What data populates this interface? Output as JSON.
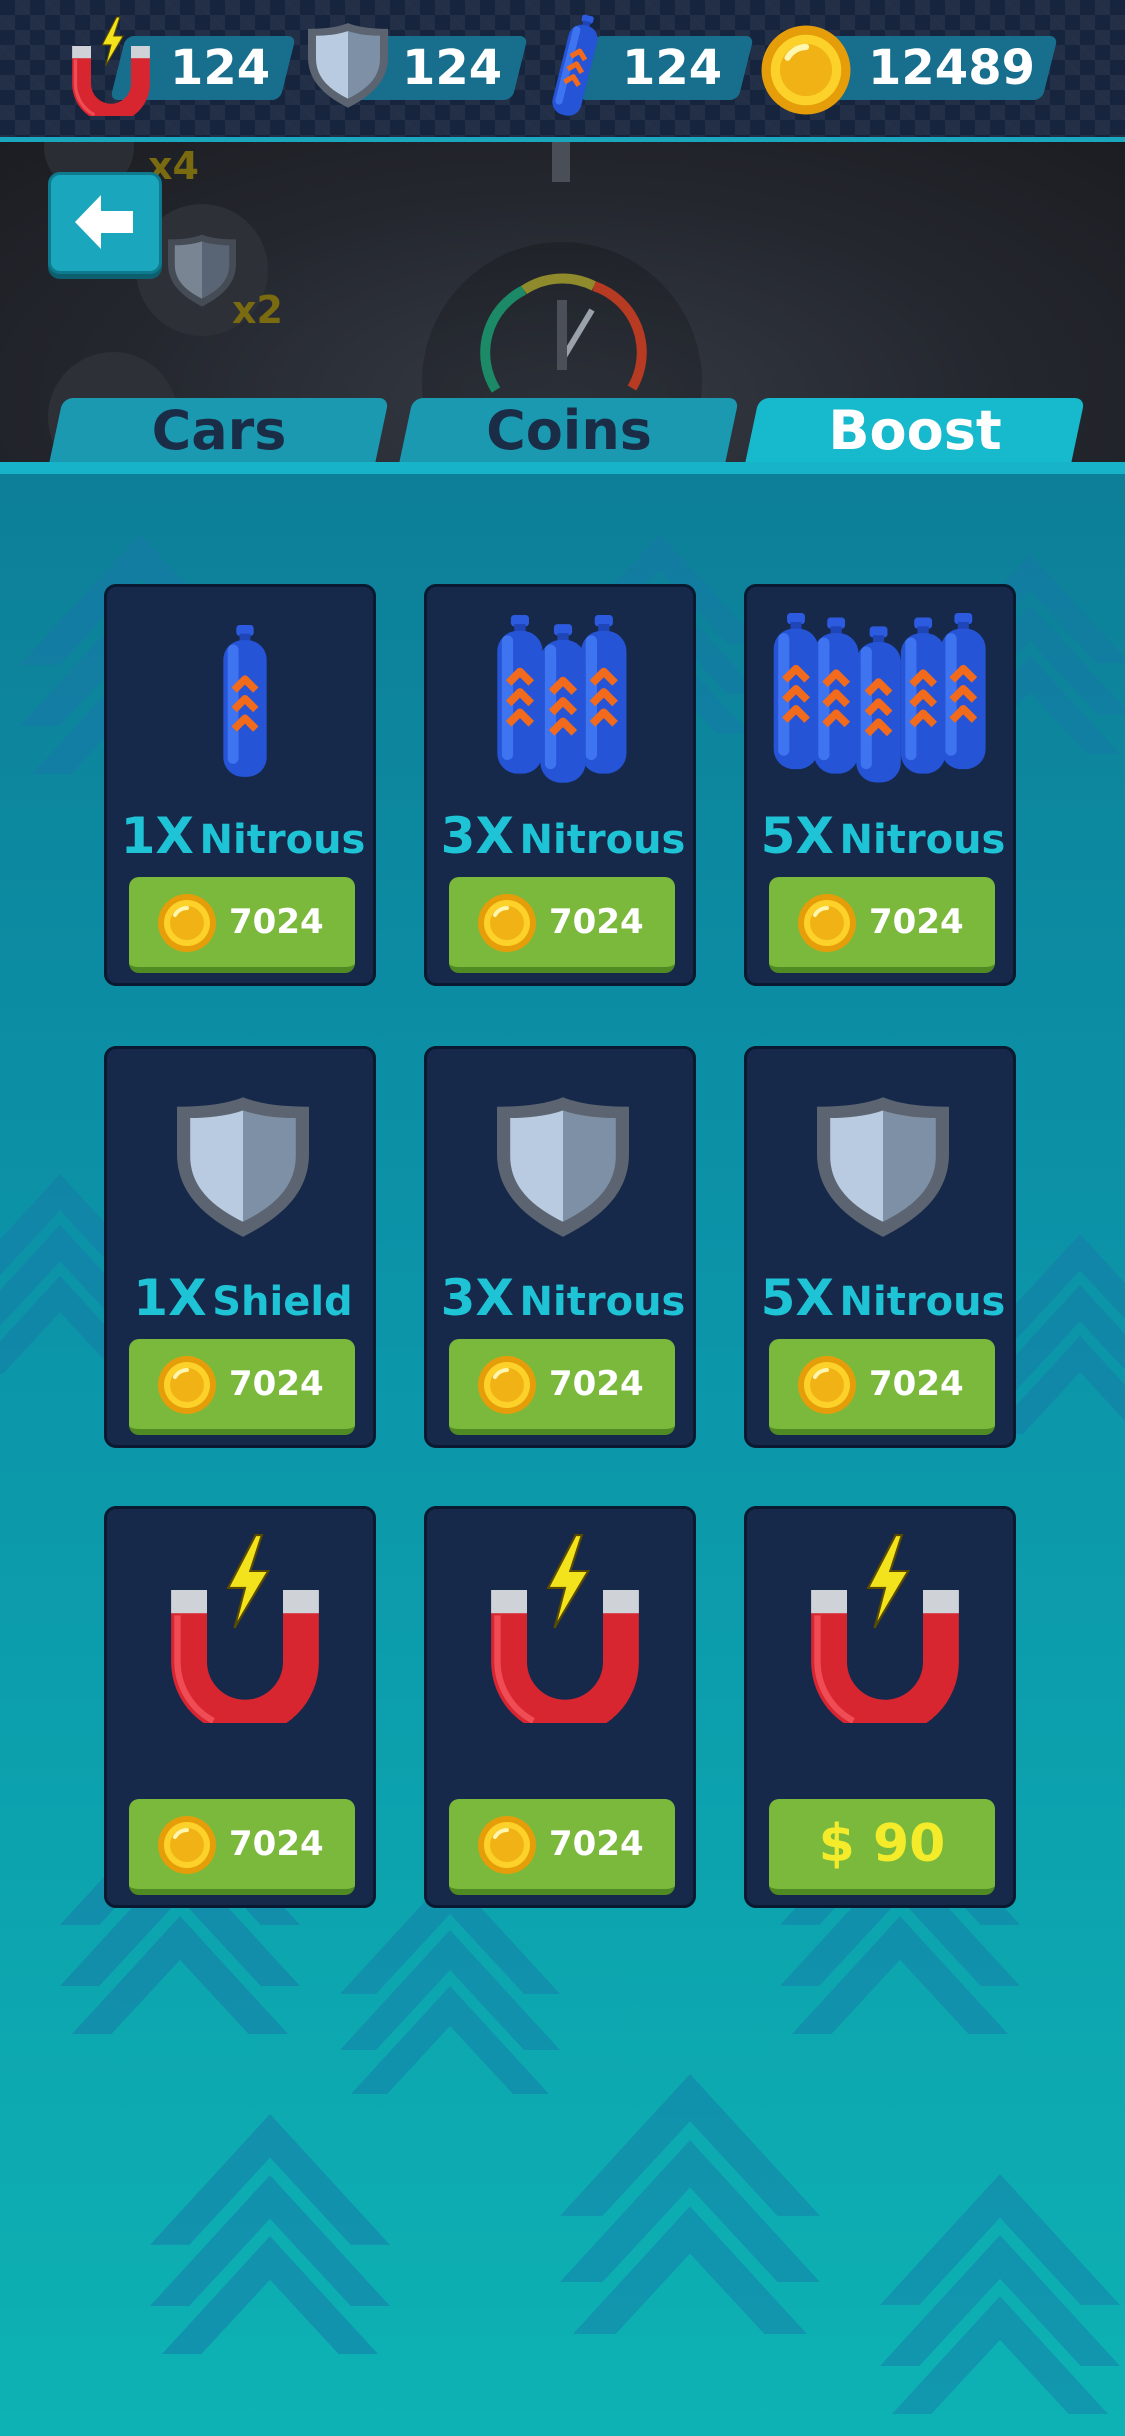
{
  "currencies": {
    "magnets": "124",
    "shields": "124",
    "nitrous": "124",
    "coins": "12489"
  },
  "scene": {
    "badge_top": "x4",
    "badge_shield": "x2"
  },
  "tabs": [
    {
      "label": "Cars",
      "active": false
    },
    {
      "label": "Coins",
      "active": false
    },
    {
      "label": "Boost",
      "active": true
    }
  ],
  "items": [
    {
      "icon": "nitrous-1-icon",
      "mult": "1X",
      "name": "Nitrous",
      "price": "7024"
    },
    {
      "icon": "nitrous-3-icon",
      "mult": "3X",
      "name": "Nitrous",
      "price": "7024"
    },
    {
      "icon": "nitrous-5-icon",
      "mult": "5X",
      "name": "Nitrous",
      "price": "7024"
    },
    {
      "icon": "shield-icon",
      "mult": "1X",
      "name": "Shield",
      "price": "7024"
    },
    {
      "icon": "shield-icon",
      "mult": "3X",
      "name": "Nitrous",
      "price": "7024"
    },
    {
      "icon": "shield-icon",
      "mult": "5X",
      "name": "Nitrous",
      "price": "7024"
    },
    {
      "icon": "magnet-icon",
      "mult": "",
      "name": "",
      "price": "7024"
    },
    {
      "icon": "magnet-icon",
      "mult": "",
      "name": "",
      "price": "7024"
    },
    {
      "icon": "magnet-icon",
      "mult": "",
      "name": "",
      "cash_price": "$ 90"
    }
  ],
  "colors": {
    "accent": "#1aa7bd",
    "card_bg": "#16294a",
    "buy_green": "#7ab93c",
    "title_cyan": "#1fc3d6",
    "cash_yellow": "#f4ec2a"
  }
}
